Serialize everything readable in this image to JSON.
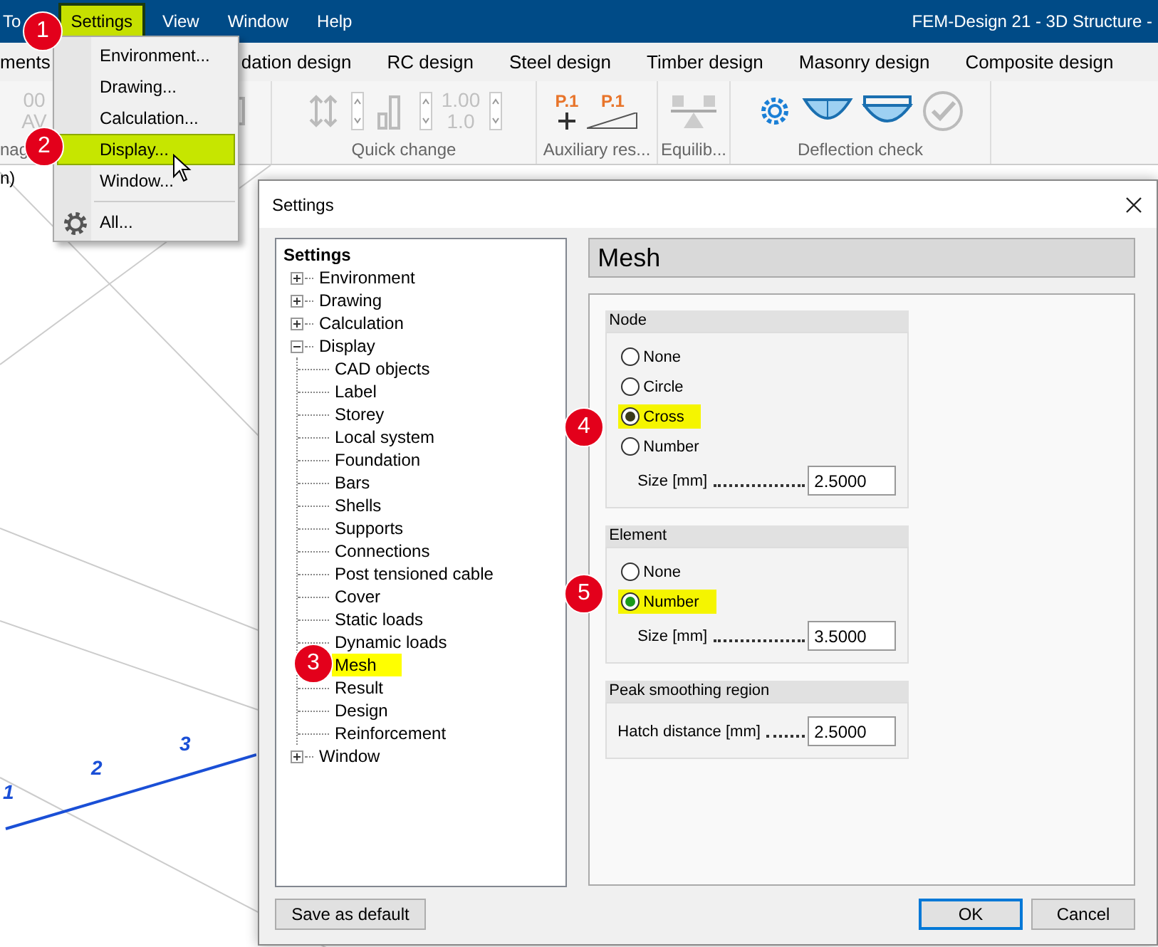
{
  "app": {
    "title": "FEM-Design 21 - 3D Structure -"
  },
  "menu": [
    {
      "label": "To",
      "selected": false
    },
    {
      "label": "Settings",
      "selected": true
    },
    {
      "label": "View",
      "selected": false
    },
    {
      "label": "Window",
      "selected": false
    },
    {
      "label": "Help",
      "selected": false
    }
  ],
  "ribbon_tabs": [
    "ments",
    "dation design",
    "RC design",
    "Steel design",
    "Timber design",
    "Masonry design",
    "Composite design"
  ],
  "ribbon": {
    "left_icon_texts": [
      "00",
      "AV"
    ],
    "quick_change_texts": [
      "1.00",
      "1.0"
    ],
    "aux_icon_texts": [
      "P.1",
      "P.1"
    ],
    "groups": [
      "nag",
      "Quick change",
      "Auxiliary res...",
      "Equilib...",
      "Deflection check"
    ]
  },
  "canvas": {
    "side_text": "n)",
    "node_numbers": [
      "1",
      "2",
      "3"
    ]
  },
  "settings_menu": [
    {
      "label": "Environment...",
      "selected": false,
      "kind": "item"
    },
    {
      "label": "Drawing...",
      "selected": false,
      "kind": "item"
    },
    {
      "label": "Calculation...",
      "selected": false,
      "kind": "item"
    },
    {
      "label": "Display...",
      "selected": true,
      "kind": "item"
    },
    {
      "label": "Window...",
      "selected": false,
      "kind": "item"
    },
    {
      "label": "All...",
      "selected": false,
      "kind": "gear"
    }
  ],
  "badges": [
    "1",
    "2",
    "3",
    "4",
    "5"
  ],
  "dialog": {
    "title": "Settings",
    "tree": {
      "label": "Settings",
      "children": [
        {
          "label": "Environment",
          "expanded": false,
          "selected": false
        },
        {
          "label": "Drawing",
          "expanded": false,
          "selected": false
        },
        {
          "label": "Calculation",
          "expanded": false,
          "selected": false
        },
        {
          "label": "Display",
          "expanded": true,
          "selected": false,
          "children": [
            {
              "label": "CAD objects",
              "selected": false
            },
            {
              "label": "Label",
              "selected": false
            },
            {
              "label": "Storey",
              "selected": false
            },
            {
              "label": "Local system",
              "selected": false
            },
            {
              "label": "Foundation",
              "selected": false
            },
            {
              "label": "Bars",
              "selected": false
            },
            {
              "label": "Shells",
              "selected": false
            },
            {
              "label": "Supports",
              "selected": false
            },
            {
              "label": "Connections",
              "selected": false
            },
            {
              "label": "Post tensioned cable",
              "selected": false
            },
            {
              "label": "Cover",
              "selected": false
            },
            {
              "label": "Static loads",
              "selected": false
            },
            {
              "label": "Dynamic loads",
              "selected": false
            },
            {
              "label": "Mesh",
              "selected": true
            },
            {
              "label": "Result",
              "selected": false
            },
            {
              "label": "Design",
              "selected": false
            },
            {
              "label": "Reinforcement",
              "selected": false
            }
          ]
        },
        {
          "label": "Window",
          "expanded": false,
          "selected": false
        }
      ]
    },
    "panel_title": "Mesh",
    "groups": [
      {
        "title": "Node",
        "options": [
          {
            "label": "None",
            "selected": false
          },
          {
            "label": "Circle",
            "selected": false
          },
          {
            "label": "Cross",
            "selected": true
          },
          {
            "label": "Number",
            "selected": false
          }
        ],
        "fields": [
          {
            "label": "Size [mm]",
            "value": "2.5000"
          }
        ]
      },
      {
        "title": "Element",
        "options": [
          {
            "label": "None",
            "selected": false
          },
          {
            "label": "Number",
            "selected": true
          }
        ],
        "fields": [
          {
            "label": "Size [mm]",
            "value": "3.5000"
          }
        ]
      },
      {
        "title": "Peak smoothing region",
        "fields": [
          {
            "label": "Hatch distance [mm]",
            "value": "2.5000"
          }
        ]
      }
    ],
    "buttons": [
      {
        "label": "Save as default",
        "default": false
      },
      {
        "label": "OK",
        "default": true
      },
      {
        "label": "Cancel",
        "default": false
      }
    ]
  }
}
